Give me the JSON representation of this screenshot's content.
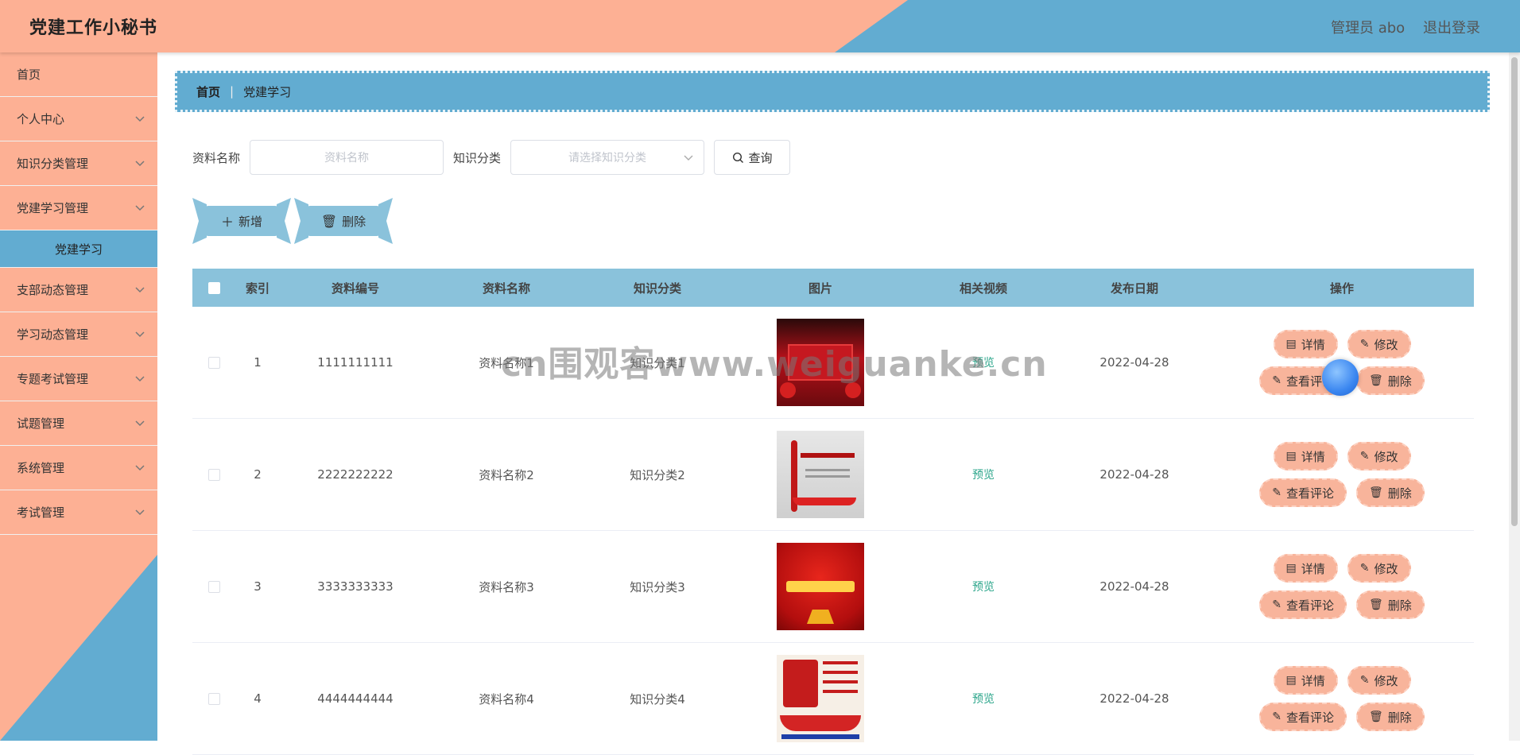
{
  "header": {
    "title": "党建工作小秘书",
    "user": "管理员 abo",
    "logout": "退出登录"
  },
  "sidebar": {
    "items": [
      {
        "label": "首页",
        "has_arrow": false
      },
      {
        "label": "个人中心",
        "has_arrow": true
      },
      {
        "label": "知识分类管理",
        "has_arrow": true
      },
      {
        "label": "党建学习管理",
        "has_arrow": true
      },
      {
        "label": "支部动态管理",
        "has_arrow": true
      },
      {
        "label": "学习动态管理",
        "has_arrow": true
      },
      {
        "label": "专题考试管理",
        "has_arrow": true
      },
      {
        "label": "试题管理",
        "has_arrow": true
      },
      {
        "label": "系统管理",
        "has_arrow": true
      },
      {
        "label": "考试管理",
        "has_arrow": true
      }
    ],
    "active_sub": "党建学习"
  },
  "breadcrumb": {
    "home": "首页",
    "current": "党建学习"
  },
  "search": {
    "name_label": "资料名称",
    "name_placeholder": "资料名称",
    "category_label": "知识分类",
    "category_placeholder": "请选择知识分类",
    "query_label": "查询"
  },
  "actions": {
    "add": "新增",
    "delete": "删除"
  },
  "table": {
    "headers": [
      "索引",
      "资料编号",
      "资料名称",
      "知识分类",
      "图片",
      "相关视频",
      "发布日期",
      "操作"
    ],
    "rows": [
      {
        "index": "1",
        "code": "1111111111",
        "name": "资料名称1",
        "category": "知识分类1",
        "video": "预览",
        "date": "2022-04-28",
        "thumb_text": ""
      },
      {
        "index": "2",
        "code": "2222222222",
        "name": "资料名称2",
        "category": "知识分类2",
        "video": "预览",
        "date": "2022-04-28",
        "thumb_text": ""
      },
      {
        "index": "3",
        "code": "3333333333",
        "name": "资料名称3",
        "category": "知识分类3",
        "video": "预览",
        "date": "2022-04-28",
        "thumb_text": ""
      },
      {
        "index": "4",
        "code": "4444444444",
        "name": "资料名称4",
        "category": "知识分类4",
        "video": "预览",
        "date": "2022-04-28",
        "thumb_text": ""
      }
    ],
    "ops": {
      "detail": "详情",
      "edit": "修改",
      "comments": "查看评论",
      "delete": "删除"
    }
  },
  "watermark": "cn围观客www.weiguanke.cn",
  "colors": {
    "peach": "#fdb094",
    "blue": "#62acd1",
    "table_header": "#8ac2db",
    "link_green": "#2aa58a"
  }
}
